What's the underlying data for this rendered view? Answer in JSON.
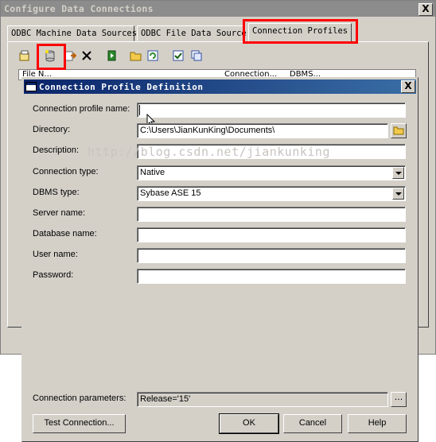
{
  "outer": {
    "title": "Configure Data Connections",
    "close": "X",
    "tabs": [
      "ODBC Machine Data Sources",
      "ODBC File Data Source",
      "Connection Profiles"
    ],
    "list_headers": [
      "File N...",
      "Connection...",
      "DBMS..."
    ]
  },
  "toolbar_icons": [
    "properties-icon",
    "new-profile-icon",
    "import-icon",
    "delete-icon",
    "test-icon",
    "open-folder-icon",
    "refresh-icon",
    "check-icon",
    "copy-icon"
  ],
  "dialog": {
    "title": "Connection Profile Definition",
    "close": "X",
    "labels": {
      "profile_name": "Connection profile name:",
      "directory": "Directory:",
      "description": "Description:",
      "connection_type": "Connection type:",
      "dbms_type": "DBMS type:",
      "server_name": "Server name:",
      "database_name": "Database name:",
      "user_name": "User name:",
      "password": "Password:",
      "parameters": "Connection parameters:"
    },
    "values": {
      "profile_name": "",
      "directory": "C:\\Users\\JianKunKing\\Documents\\",
      "description": "",
      "connection_type": "Native",
      "dbms_type": "Sybase ASE 15",
      "server_name": "",
      "database_name": "",
      "user_name": "",
      "password": "",
      "parameters": "Release='15'"
    },
    "buttons": {
      "ellipsis": "...",
      "test": "Test Connection...",
      "ok": "OK",
      "cancel": "Cancel",
      "help": "Help"
    }
  },
  "watermark": "http://blog.csdn.net/jiankunking"
}
